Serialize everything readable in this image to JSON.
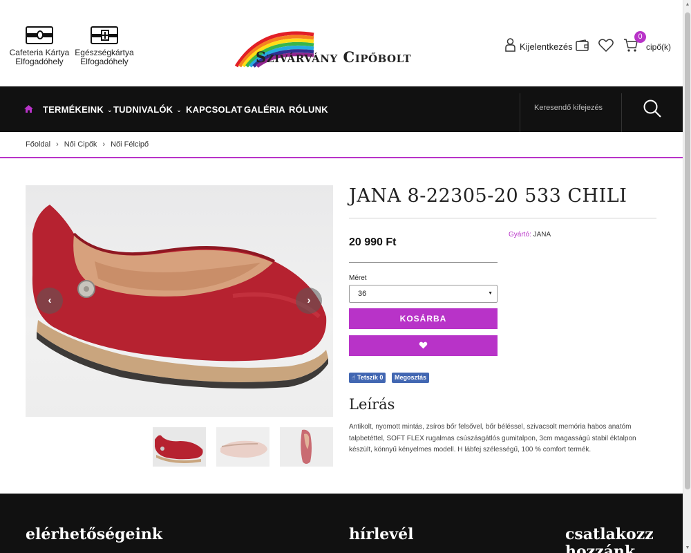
{
  "header": {
    "cards": [
      {
        "label_line1": "Cafeteria Kártya",
        "label_line2": "Elfogadóhely",
        "icon": "card-dot-icon"
      },
      {
        "label_line1": "Egészségkártya",
        "label_line2": "Elfogadóhely",
        "icon": "card-plus-icon"
      }
    ],
    "logo_text": "Szivárvány Cipőbolt",
    "logout_label": "Kijelentkezés",
    "cart_count": "0",
    "cart_label": "cipő(k)"
  },
  "nav": {
    "items": [
      {
        "label": "TERMÉKEINK",
        "has_caret": true
      },
      {
        "label": "TUDNIVALÓK",
        "has_caret": true
      },
      {
        "label": "KAPCSOLAT",
        "has_caret": false
      },
      {
        "label": "GALÉRIA",
        "has_caret": false
      },
      {
        "label": "RÓLUNK",
        "has_caret": false
      }
    ],
    "search_placeholder": "Keresendő kifejezés"
  },
  "breadcrumb": [
    "Főoldal",
    "Női Cipők",
    "Női Félcipő"
  ],
  "product": {
    "title": "JANA 8-22305-20 533 CHILI",
    "price": "20 990 Ft",
    "manufacturer_label": "Gyártó:",
    "manufacturer": "JANA",
    "size_label": "Méret",
    "size_value": "36",
    "add_to_cart": "KOSÁRBA",
    "fb_like": "Tetszik 0",
    "fb_share": "Megosztás",
    "description_title": "Leírás",
    "description": "Antikolt, nyomott mintás, zsíros bőr felsővel, bőr béléssel, szivacsolt memória habos anatóm talpbetéttel, SOFT FLEX rugalmas csúszásgátlós gumitalpon, 3cm magasságú stabil éktalpon készült, könnyű kényelmes modell. H lábfej szélességű, 100 % comfort termék."
  },
  "footer": {
    "col1": "elérhetőségeink",
    "col2": "hírlevél",
    "col3_line1": "csatlakozz",
    "col3_line2": "hozzánk"
  },
  "colors": {
    "accent": "#b833c8",
    "nav_bg": "#111111",
    "footer_bg": "#111111"
  }
}
